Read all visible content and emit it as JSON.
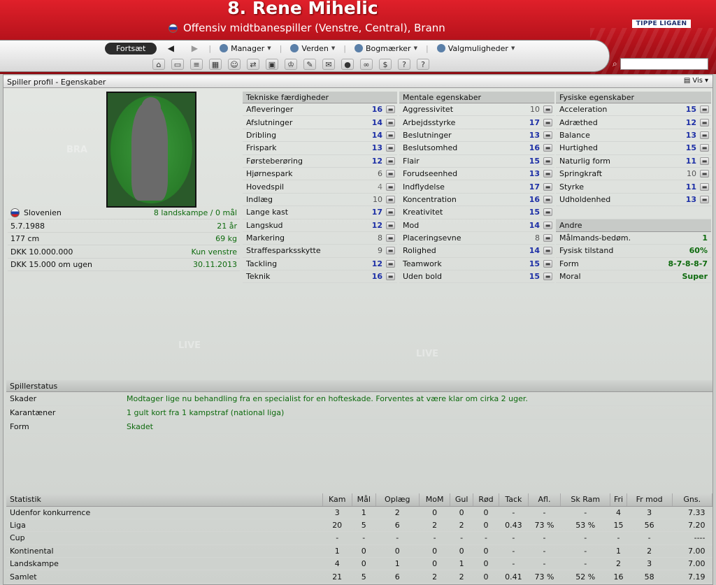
{
  "header": {
    "player_name": "8. Rene Mihelic",
    "subtitle": "Offensiv midtbanespiller (Venstre, Central), Brann",
    "league_logo": "TIPPE LIGAEN"
  },
  "nav": {
    "continue_label": "Fortsæt",
    "menus": [
      "Manager",
      "Verden",
      "Bogmærker",
      "Valgmuligheder"
    ],
    "toolbar_icons": [
      "home-icon",
      "profile-icon",
      "news-icon",
      "calendar-icon",
      "team-icon",
      "transfer-icon",
      "tactics-icon",
      "trophy-icon",
      "scout-icon",
      "notes-icon",
      "match-icon",
      "binoculars-icon",
      "finance-icon",
      "help-icon",
      "info-icon"
    ]
  },
  "panel": {
    "title": "Spiller profil - Egenskaber",
    "view_label": "Vis"
  },
  "info": [
    {
      "label": "Slovenien",
      "value": "8 landskampe / 0 mål"
    },
    {
      "label": "5.7.1988",
      "value": "21 år"
    },
    {
      "label": "177 cm",
      "value": "69 kg"
    },
    {
      "label": "DKK 10.000.000",
      "value": "Kun venstre"
    },
    {
      "label": "DKK 15.000 om ugen",
      "value": "30.11.2013"
    }
  ],
  "technical": {
    "title": "Tekniske færdigheder",
    "rows": [
      {
        "name": "Afleveringer",
        "value": "16"
      },
      {
        "name": "Afslutninger",
        "value": "14"
      },
      {
        "name": "Dribling",
        "value": "14"
      },
      {
        "name": "Frispark",
        "value": "13"
      },
      {
        "name": "Førsteberøring",
        "value": "12"
      },
      {
        "name": "Hjørnespark",
        "value": "6"
      },
      {
        "name": "Hovedspil",
        "value": "4"
      },
      {
        "name": "Indlæg",
        "value": "10"
      },
      {
        "name": "Lange kast",
        "value": "17"
      },
      {
        "name": "Langskud",
        "value": "12"
      },
      {
        "name": "Markering",
        "value": "8"
      },
      {
        "name": "Straffesparksskytte",
        "value": "9"
      },
      {
        "name": "Tackling",
        "value": "12"
      },
      {
        "name": "Teknik",
        "value": "16"
      }
    ]
  },
  "mental": {
    "title": "Mentale egenskaber",
    "rows": [
      {
        "name": "Aggressivitet",
        "value": "10"
      },
      {
        "name": "Arbejdsstyrke",
        "value": "17"
      },
      {
        "name": "Beslutninger",
        "value": "13"
      },
      {
        "name": "Beslutsomhed",
        "value": "16"
      },
      {
        "name": "Flair",
        "value": "15"
      },
      {
        "name": "Forudseenhed",
        "value": "13"
      },
      {
        "name": "Indflydelse",
        "value": "17"
      },
      {
        "name": "Koncentration",
        "value": "16"
      },
      {
        "name": "Kreativitet",
        "value": "15"
      },
      {
        "name": "Mod",
        "value": "14"
      },
      {
        "name": "Placeringsevne",
        "value": "8"
      },
      {
        "name": "Rolighed",
        "value": "14"
      },
      {
        "name": "Teamwork",
        "value": "15"
      },
      {
        "name": "Uden bold",
        "value": "15"
      }
    ]
  },
  "physical": {
    "title": "Fysiske egenskaber",
    "rows": [
      {
        "name": "Acceleration",
        "value": "15"
      },
      {
        "name": "Adræthed",
        "value": "12"
      },
      {
        "name": "Balance",
        "value": "13"
      },
      {
        "name": "Hurtighed",
        "value": "15"
      },
      {
        "name": "Naturlig form",
        "value": "11"
      },
      {
        "name": "Springkraft",
        "value": "10"
      },
      {
        "name": "Styrke",
        "value": "11"
      },
      {
        "name": "Udholdenhed",
        "value": "13"
      }
    ]
  },
  "other": {
    "title": "Andre",
    "rows": [
      {
        "name": "Målmands-bedøm.",
        "value": "1"
      },
      {
        "name": "Fysisk tilstand",
        "value": "60%"
      },
      {
        "name": "Form",
        "value": "8-7-8-8-7"
      },
      {
        "name": "Moral",
        "value": "Super"
      }
    ]
  },
  "status": {
    "title": "Spillerstatus",
    "rows": [
      {
        "label": "Skader",
        "text": "Modtager lige nu behandling fra en specialist for en hofteskade. Forventes at være klar om cirka 2 uger."
      },
      {
        "label": "Karantæner",
        "text": "1 gult kort fra 1 kampstraf (national liga)"
      },
      {
        "label": "Form",
        "text": "Skadet"
      }
    ]
  },
  "stats": {
    "headers": [
      "Statistik",
      "Kam",
      "Mål",
      "Oplæg",
      "MoM",
      "Gul",
      "Rød",
      "Tack",
      "Afl.",
      "Sk Ram",
      "Fri",
      "Fr mod",
      "Gns."
    ],
    "rows": [
      [
        "Udenfor konkurrence",
        "3",
        "1",
        "2",
        "0",
        "0",
        "0",
        "-",
        "-",
        "-",
        "4",
        "3",
        "7.33"
      ],
      [
        "Liga",
        "20",
        "5",
        "6",
        "2",
        "2",
        "0",
        "0.43",
        "73 %",
        "53 %",
        "15",
        "56",
        "7.20"
      ],
      [
        "Cup",
        "-",
        "-",
        "-",
        "-",
        "-",
        "-",
        "-",
        "-",
        "-",
        "-",
        "-",
        "----"
      ],
      [
        "Kontinental",
        "1",
        "0",
        "0",
        "0",
        "0",
        "0",
        "-",
        "-",
        "-",
        "1",
        "2",
        "7.00"
      ],
      [
        "Landskampe",
        "4",
        "0",
        "1",
        "0",
        "1",
        "0",
        "-",
        "-",
        "-",
        "2",
        "3",
        "7.00"
      ],
      [
        "Samlet",
        "21",
        "5",
        "6",
        "2",
        "2",
        "0",
        "0.41",
        "73 %",
        "52 %",
        "16",
        "58",
        "7.19"
      ]
    ]
  },
  "colors": {
    "header_red": "#c8151e",
    "attr_blue": "#1d2fa6",
    "value_green": "#0d6a0d"
  }
}
